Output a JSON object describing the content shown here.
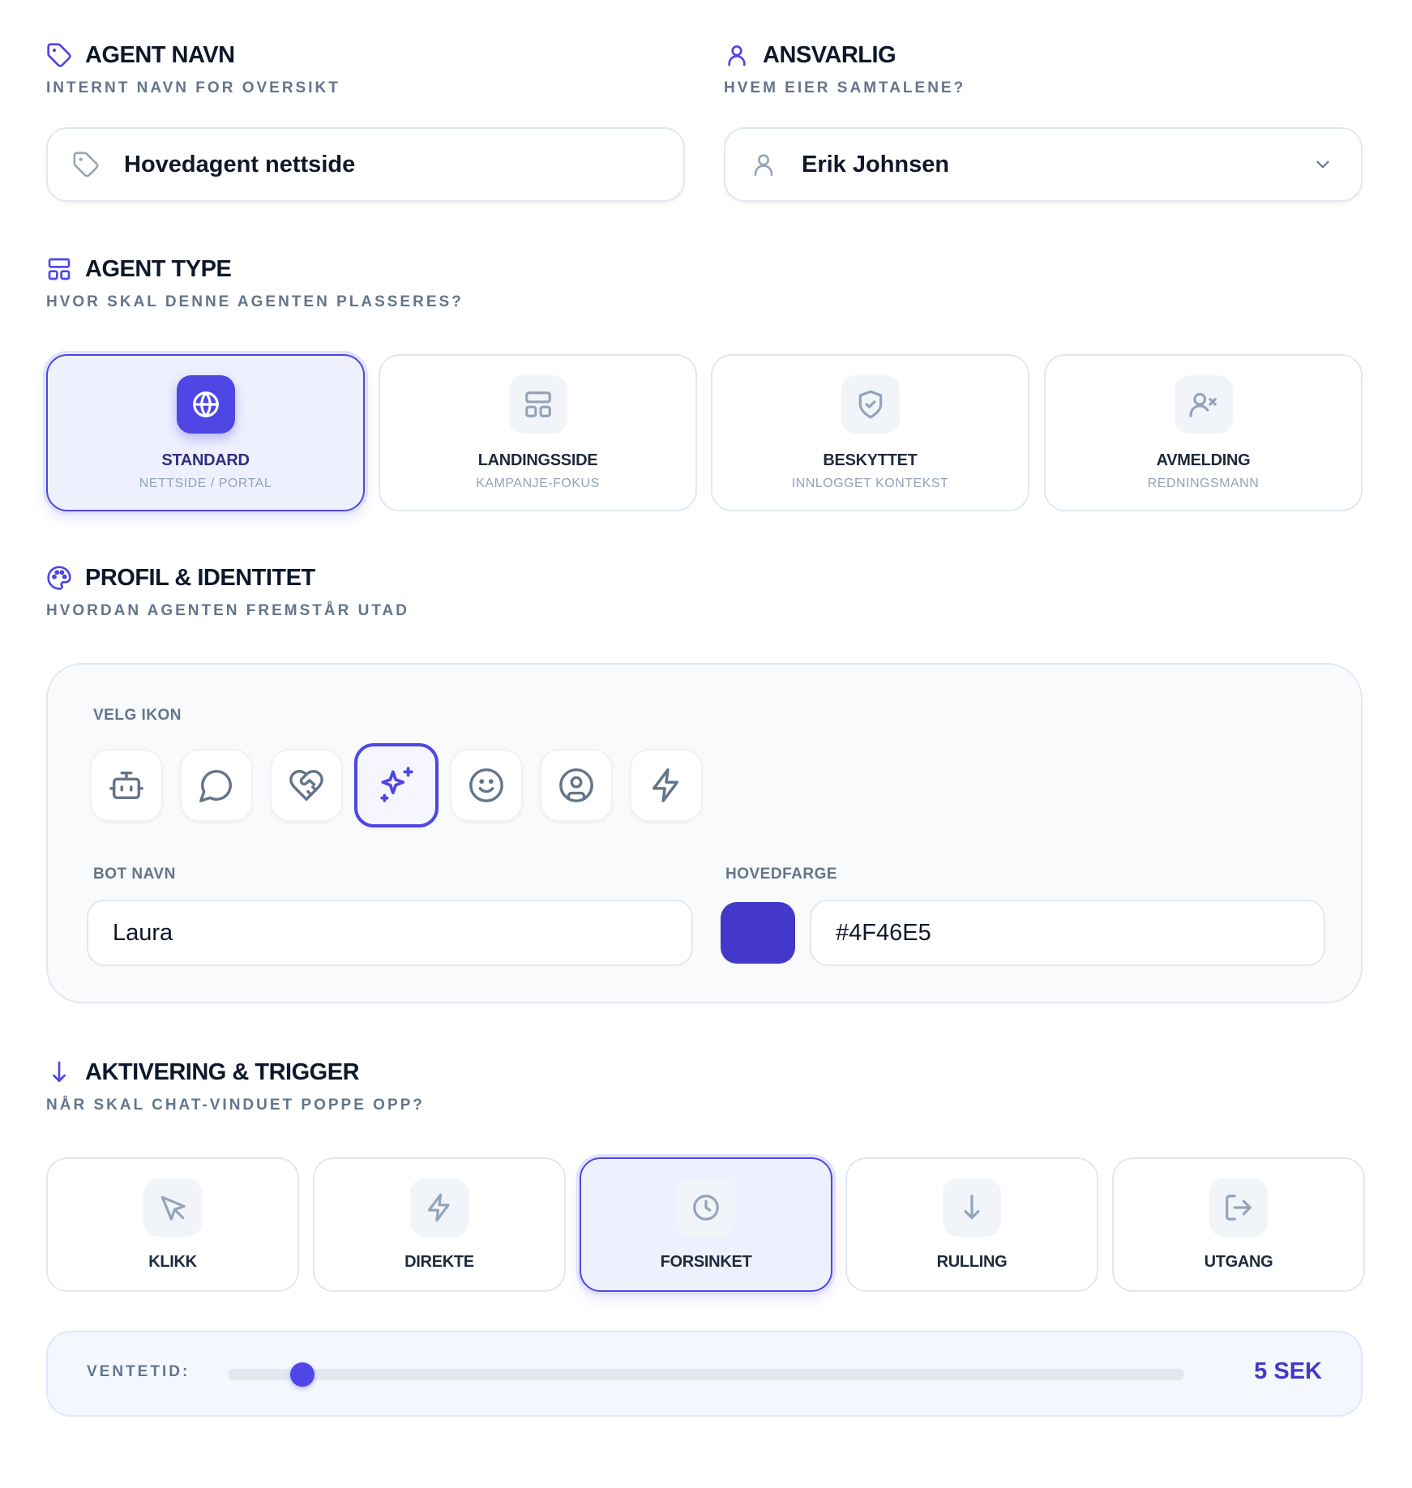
{
  "agent_name": {
    "title": "AGENT NAVN",
    "subtitle": "INTERNT NAVN FOR OVERSIKT",
    "value": "Hovedagent nettside"
  },
  "owner": {
    "title": "ANSVARLIG",
    "subtitle": "HVEM EIER SAMTALENE?",
    "value": "Erik Johnsen"
  },
  "agent_type": {
    "title": "AGENT TYPE",
    "subtitle": "HVOR SKAL DENNE AGENTEN PLASSERES?",
    "selected": "standard",
    "options": [
      {
        "label": "STANDARD",
        "sub": "NETTSIDE / PORTAL",
        "icon": "globe-icon"
      },
      {
        "label": "LANDINGSSIDE",
        "sub": "KAMPANJE-FOKUS",
        "icon": "layout-icon"
      },
      {
        "label": "BESKYTTET",
        "sub": "INNLOGGET KONTEKST",
        "icon": "shield-check-icon"
      },
      {
        "label": "AVMELDING",
        "sub": "REDNINGSMANN",
        "icon": "user-x-icon"
      }
    ]
  },
  "profile": {
    "title": "PROFIL & IDENTITET",
    "subtitle": "HVORDAN AGENTEN FREMSTÅR UTAD",
    "icon_label": "VELG IKON",
    "icons": [
      "bot-icon",
      "chat-bubble-icon",
      "heart-handshake-icon",
      "sparkles-icon",
      "smile-icon",
      "user-circle-icon",
      "zap-icon"
    ],
    "selected_icon": "sparkles-icon",
    "bot_name_label": "BOT NAVN",
    "bot_name": "Laura",
    "color_label": "HOVEDFARGE",
    "color_value": "#4F46E5",
    "accent_color": "#4F46E5"
  },
  "activation": {
    "title": "AKTIVERING & TRIGGER",
    "subtitle": "NÅR SKAL CHAT-VINDUET POPPE OPP?",
    "selected": "forsinket",
    "options": [
      {
        "label": "KLIKK",
        "icon": "pointer-icon"
      },
      {
        "label": "DIREKTE",
        "icon": "zap-icon"
      },
      {
        "label": "FORSINKET",
        "icon": "clock-icon"
      },
      {
        "label": "RULLING",
        "icon": "arrow-down-icon"
      },
      {
        "label": "UTGANG",
        "icon": "exit-icon"
      }
    ],
    "delay_label": "VENTETID:",
    "delay_fraction": 0.078,
    "delay_value": "5 SEK"
  }
}
